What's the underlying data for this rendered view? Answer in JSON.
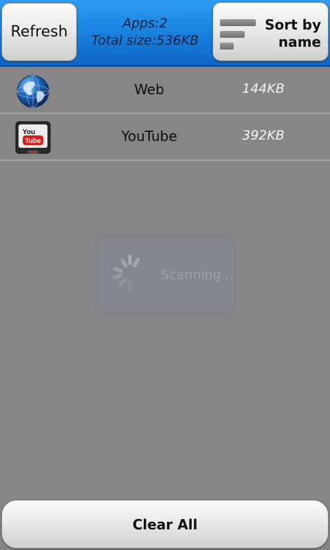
{
  "header": {
    "refresh_label": "Refresh",
    "apps_count_label": "Apps:2",
    "total_size_label": "Total size:536KB",
    "sort_label_line1": "Sort by",
    "sort_label_line2": "name",
    "sort_icon": "sort-bars-icon"
  },
  "apps": [
    {
      "name": "Web",
      "size": "144KB",
      "icon": "globe-icon"
    },
    {
      "name": "YouTube",
      "size": "392KB",
      "icon": "youtube-icon",
      "icon_text_top": "You",
      "icon_text_bottom": "Tube"
    }
  ],
  "scanning": {
    "label": "Scanning...",
    "icon": "spinner-icon"
  },
  "footer": {
    "clear_label": "Clear All"
  },
  "colors": {
    "header_blue": "#1a84e0",
    "background": "#878587",
    "button_light": "#e8e8e8",
    "youtube_red": "#d6201c"
  }
}
